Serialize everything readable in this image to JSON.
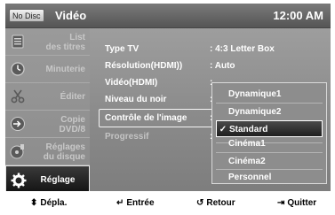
{
  "topbar": {
    "disc_badge": "No Disc",
    "title": "Vidéo",
    "clock": "12:00 AM"
  },
  "sidebar": {
    "items": [
      {
        "label": "List\ndes titres",
        "icon": "title-list-icon",
        "active": false
      },
      {
        "label": "Minuterie",
        "icon": "timer-clock-icon",
        "active": false
      },
      {
        "label": "Éditer",
        "icon": "edit-scissors-icon",
        "active": false
      },
      {
        "label": "Copie\nDVD/8",
        "icon": "copy-disc-icon",
        "active": false
      },
      {
        "label": "Réglages\ndu disque",
        "icon": "disc-settings-icon",
        "active": false
      },
      {
        "label": "Réglage",
        "icon": "gear-icon",
        "active": true
      }
    ]
  },
  "settings": {
    "rows": [
      {
        "key": "Type TV",
        "value": ": 4:3 Letter Box",
        "dim": false
      },
      {
        "key": "Résolution(HDMI))",
        "value": ": Auto",
        "dim": false
      },
      {
        "key": "Vidéo(HDMI)",
        "value": ":",
        "dim": false
      },
      {
        "key": "Niveau du noir",
        "value": ":",
        "dim": false
      },
      {
        "key": "Contrôle de l'image",
        "value": ":",
        "dim": false
      },
      {
        "key": "Progressif",
        "value": ":",
        "dim": true
      }
    ],
    "focused_row": "Contrôle de l'image"
  },
  "dropdown": {
    "options": [
      "Dynamique1",
      "Dynamique2",
      "Standard",
      "Cinéma1",
      "Cinéma2",
      "Personnel"
    ],
    "selected": "Standard",
    "check_glyph": "✓"
  },
  "bottombar": {
    "hints": [
      {
        "icon": "updown-arrows-icon",
        "glyph": "⬍",
        "label": "Dépla."
      },
      {
        "icon": "enter-icon",
        "glyph": "↵",
        "label": "Entrée"
      },
      {
        "icon": "return-icon",
        "glyph": "↺",
        "label": "Retour"
      },
      {
        "icon": "exit-icon",
        "glyph": "⇥",
        "label": "Quitter"
      }
    ]
  },
  "colors": {
    "panel": "#8c8c8c",
    "topbar": "#555555",
    "active_item": "#111111",
    "text": "#ffffff"
  }
}
